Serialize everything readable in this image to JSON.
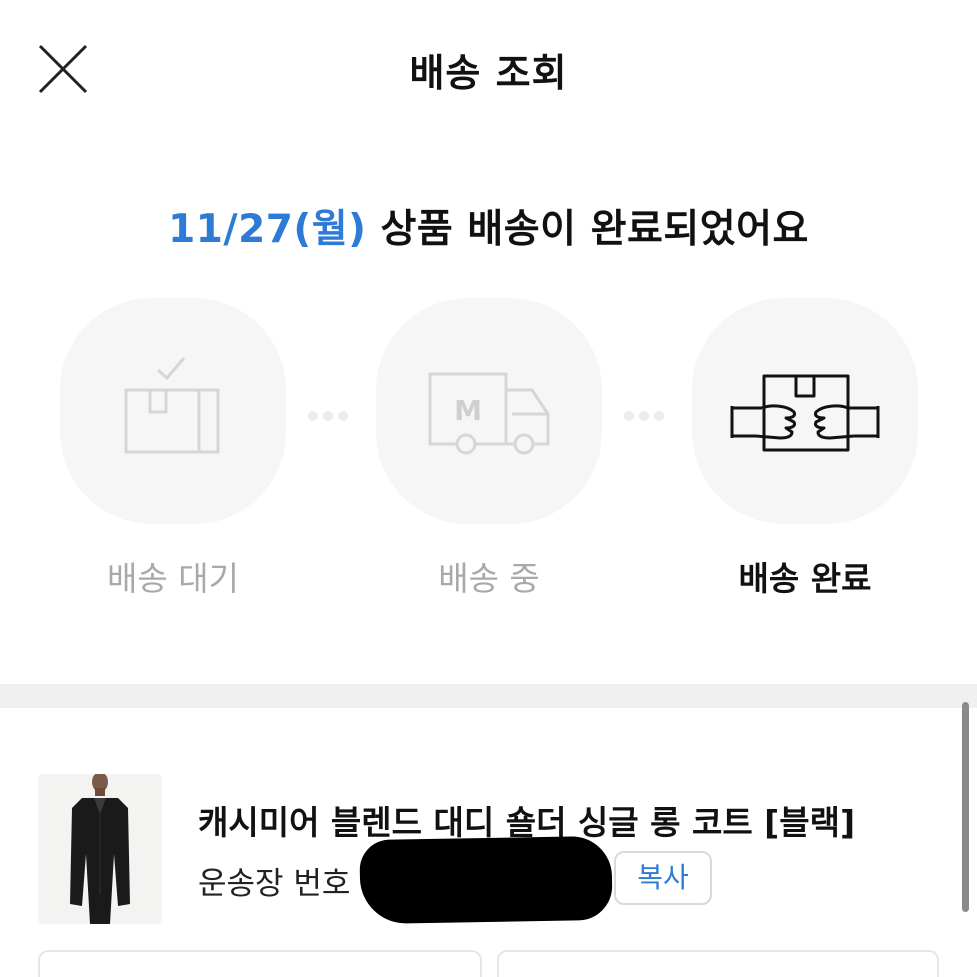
{
  "header": {
    "title": "배송 조회"
  },
  "status": {
    "date": "11/27(월)",
    "message": " 상품 배송이 완료되었어요"
  },
  "steps": [
    {
      "label": "배송 대기",
      "icon": "box-check-icon",
      "active": false
    },
    {
      "label": "배송 중",
      "icon": "delivery-truck-icon",
      "active": false
    },
    {
      "label": "배송 완료",
      "icon": "hands-box-icon",
      "active": true
    }
  ],
  "truck_letter": "M",
  "product": {
    "name": "캐시미어 블렌드 대디 숄더 싱글 롱 코트 [블랙]",
    "tracking_label": "운송장 번호 5",
    "copy_label": "복사"
  },
  "colors": {
    "accent": "#2e7bd6",
    "inactive": "#a9a9a9",
    "divider": "#f0f0f0"
  }
}
